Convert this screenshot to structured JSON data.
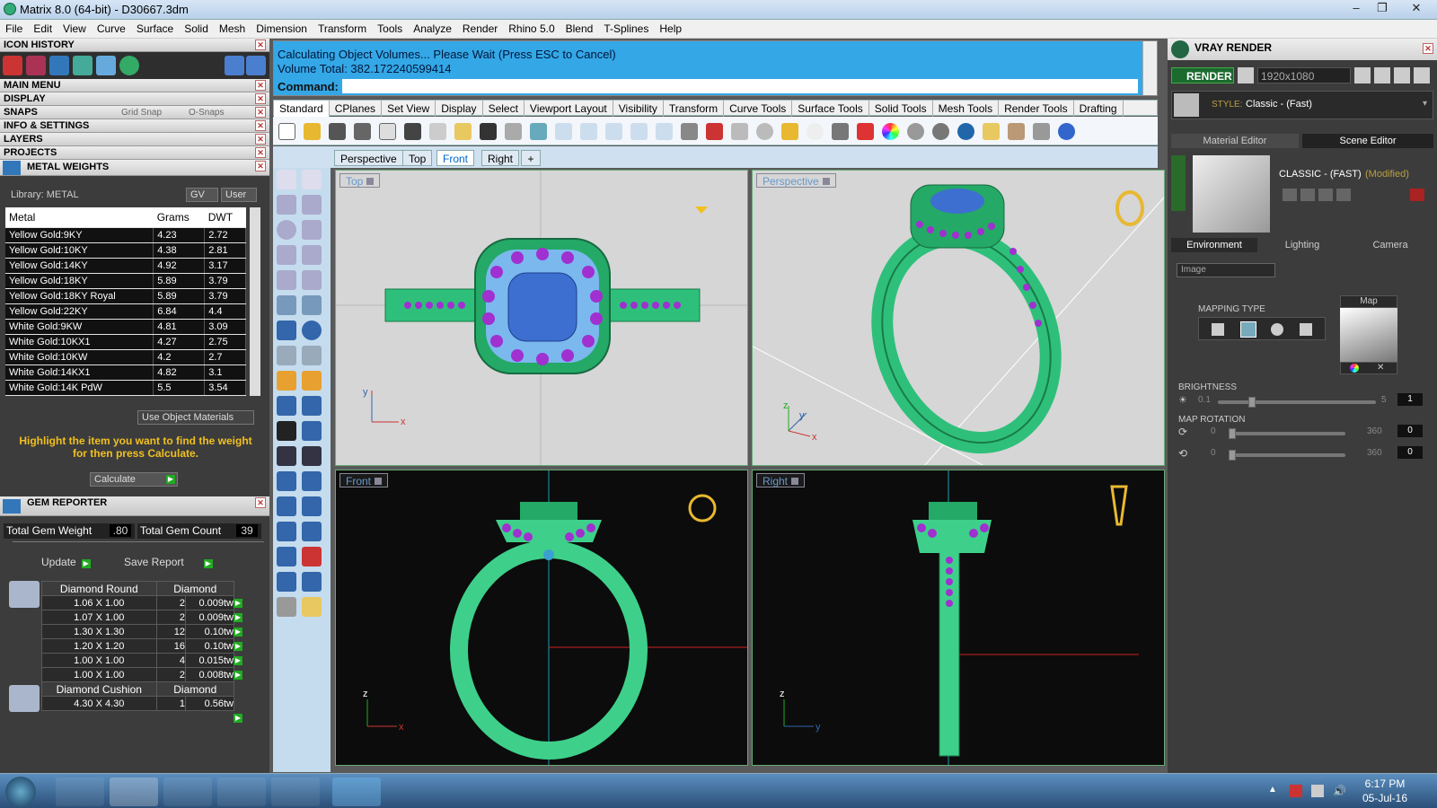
{
  "window": {
    "title": "Matrix 8.0 (64-bit) - D30667.3dm"
  },
  "menu": [
    "File",
    "Edit",
    "View",
    "Curve",
    "Surface",
    "Solid",
    "Mesh",
    "Dimension",
    "Transform",
    "Tools",
    "Analyze",
    "Render",
    "Rhino 5.0",
    "Blend",
    "T-Splines",
    "Help"
  ],
  "left": {
    "icon_history": "ICON HISTORY",
    "main_menu": "MAIN MENU",
    "display": "DISPLAY",
    "snaps": "SNAPS",
    "grid_snap": "Grid Snap",
    "o_snaps": "O-Snaps",
    "info_settings": "INFO & SETTINGS",
    "layers": "LAYERS",
    "projects": "PROJECTS",
    "metal_weights": "METAL WEIGHTS",
    "library": "Library: METAL",
    "gv": "GV",
    "user": "User",
    "cols": [
      "Metal",
      "Grams",
      "DWT"
    ],
    "metals": [
      [
        "Yellow Gold:9KY",
        "4.23",
        "2.72"
      ],
      [
        "Yellow Gold:10KY",
        "4.38",
        "2.81"
      ],
      [
        "Yellow Gold:14KY",
        "4.92",
        "3.17"
      ],
      [
        "Yellow Gold:18KY",
        "5.89",
        "3.79"
      ],
      [
        "Yellow Gold:18KY Royal",
        "5.89",
        "3.79"
      ],
      [
        "Yellow Gold:22KY",
        "6.84",
        "4.4"
      ],
      [
        "White Gold:9KW",
        "4.81",
        "3.09"
      ],
      [
        "White Gold:10KX1",
        "4.27",
        "2.75"
      ],
      [
        "White Gold:10KW",
        "4.2",
        "2.7"
      ],
      [
        "White Gold:14KX1",
        "4.82",
        "3.1"
      ],
      [
        "White Gold:14K PdW",
        "5.5",
        "3.54"
      ]
    ],
    "use_object_materials": "Use Object Materials",
    "hint": "Highlight the item you want to find the weight for then press Calculate.",
    "calculate": "Calculate",
    "gem_reporter": "GEM REPORTER",
    "total_gem_weight_label": "Total Gem Weight",
    "total_gem_weight": ".80",
    "total_gem_count_label": "Total Gem Count",
    "total_gem_count": "39",
    "update": "Update",
    "save_report": "Save Report",
    "gems_round_header": [
      "Diamond Round",
      "Diamond"
    ],
    "gems_round": [
      [
        "1.06 X 1.00",
        "2",
        "0.009tw"
      ],
      [
        "1.07 X 1.00",
        "2",
        "0.009tw"
      ],
      [
        "1.30 X 1.30",
        "12",
        "0.10tw"
      ],
      [
        "1.20 X 1.20",
        "16",
        "0.10tw"
      ],
      [
        "1.00 X 1.00",
        "4",
        "0.015tw"
      ],
      [
        "1.00 X 1.00",
        "2",
        "0.008tw"
      ]
    ],
    "gems_cushion_header": [
      "Diamond Cushion",
      "Diamond"
    ],
    "gems_cushion": [
      [
        "4.30 X 4.30",
        "1",
        "0.56tw"
      ]
    ]
  },
  "command": {
    "line1": "Calculating Object Volumes... Please Wait (Press ESC to Cancel)",
    "line2": "Volume Total: 382.172240599414",
    "prompt": "Command:"
  },
  "tabs": [
    "Standard",
    "CPlanes",
    "Set View",
    "Display",
    "Select",
    "Viewport Layout",
    "Visibility",
    "Transform",
    "Curve Tools",
    "Surface Tools",
    "Solid Tools",
    "Mesh Tools",
    "Render Tools",
    "Drafting"
  ],
  "viewport_tabs": [
    "Perspective",
    "Top",
    "Front",
    "Right"
  ],
  "viewports": {
    "top": "Top",
    "perspective": "Perspective",
    "front": "Front",
    "right": "Right"
  },
  "axes": {
    "x": "x",
    "y": "y",
    "z": "z"
  },
  "right": {
    "title": "VRAY RENDER",
    "render": "RENDER",
    "resolution": "1920x1080",
    "style_label": "STYLE:",
    "style": "Classic - (Fast)",
    "material_editor": "Material Editor",
    "scene_editor": "Scene Editor",
    "scene_name": "CLASSIC - (FAST)",
    "modified": "(Modified)",
    "env_tabs": [
      "Environment",
      "Lighting",
      "Camera"
    ],
    "env_type": "Image",
    "mapping_type": "MAPPING TYPE",
    "map": "Map",
    "brightness": "BRIGHTNESS",
    "bright_min": "0.1",
    "bright_max": "5",
    "bright_val": "1",
    "bright_level": 0.2,
    "map_rotation": "MAP ROTATION",
    "rot": [
      [
        "0",
        "360",
        "0"
      ],
      [
        "0",
        "360",
        "0"
      ]
    ]
  },
  "taskbar": {
    "time": "6:17 PM",
    "date": "05-Jul-16"
  }
}
